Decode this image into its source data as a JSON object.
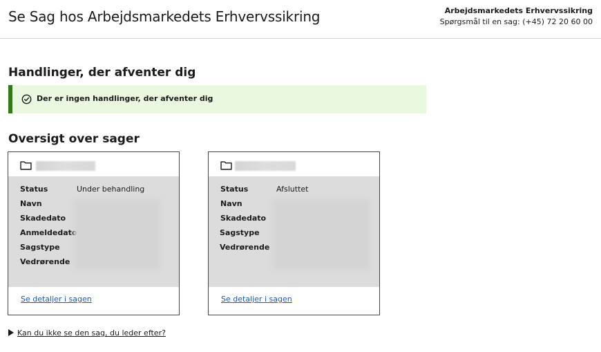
{
  "header": {
    "title": "Se Sag hos Arbejdsmarkedets Erhvervssikring",
    "org_name": "Arbejdsmarkedets Erhvervssikring",
    "contact": "Spørgsmål til en sag: (+45) 72 20 60 00"
  },
  "actions": {
    "title": "Handlinger, der afventer dig",
    "notice": "Der er ingen handlinger, der afventer dig",
    "notice_icon": "check-circle-icon",
    "accent_color": "#2e7d12",
    "background_color": "#ebf8e0"
  },
  "overview": {
    "title": "Oversigt over sager",
    "cases": [
      {
        "folder_icon": "folder-icon",
        "labels": [
          "Status",
          "Navn",
          "Skadedato",
          "Anmeldedato",
          "Sagstype",
          "Vedrørende"
        ],
        "status_value": "Under behandling",
        "link": "Se detaljer i sagen"
      },
      {
        "folder_icon": "folder-icon",
        "labels": [
          "Status",
          "Navn",
          "Skadedato",
          "Sagstype",
          "Vedrørende"
        ],
        "status_value": "Afsluttet",
        "link": "Se detaljer i sagen"
      }
    ]
  },
  "disclosure": {
    "text": "Kan du ikke se den sag, du leder efter?"
  }
}
